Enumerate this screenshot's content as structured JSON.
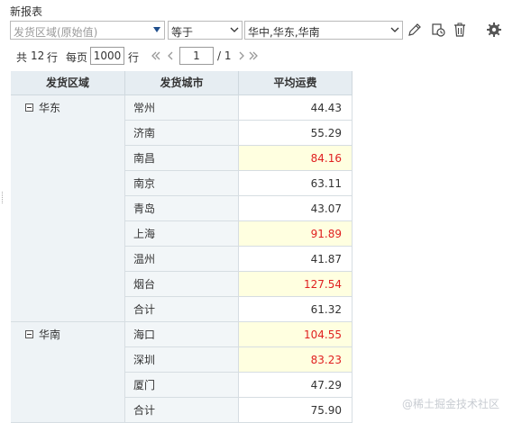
{
  "report": {
    "title": "新报表"
  },
  "filter": {
    "field_placeholder": "发货区域(原始值)",
    "operator": "等于",
    "value": "华中,华东,华南"
  },
  "pager": {
    "total_prefix": "共",
    "total_count": "12",
    "total_suffix": "行",
    "per_page_label": "每页",
    "per_page": "1000",
    "per_page_unit": "行",
    "current_page": "1",
    "total_pages": "/ 1"
  },
  "table": {
    "columns": [
      "发货区域",
      "发货城市",
      "平均运费"
    ],
    "regions": [
      {
        "name": "华东",
        "rows": [
          {
            "city": "常州",
            "value": "44.43",
            "highlight": false
          },
          {
            "city": "济南",
            "value": "55.29",
            "highlight": false
          },
          {
            "city": "南昌",
            "value": "84.16",
            "highlight": true
          },
          {
            "city": "南京",
            "value": "63.11",
            "highlight": false
          },
          {
            "city": "青岛",
            "value": "43.07",
            "highlight": false
          },
          {
            "city": "上海",
            "value": "91.89",
            "highlight": true
          },
          {
            "city": "温州",
            "value": "41.87",
            "highlight": false
          },
          {
            "city": "烟台",
            "value": "127.54",
            "highlight": true
          },
          {
            "city": "合计",
            "value": "61.32",
            "highlight": false
          }
        ]
      },
      {
        "name": "华南",
        "rows": [
          {
            "city": "海口",
            "value": "104.55",
            "highlight": true
          },
          {
            "city": "深圳",
            "value": "83.23",
            "highlight": true
          },
          {
            "city": "厦门",
            "value": "47.29",
            "highlight": false
          },
          {
            "city": "合计",
            "value": "75.90",
            "highlight": false
          }
        ]
      }
    ]
  },
  "colors": {
    "highlight_bg": "#ffffe0",
    "highlight_text": "#e02020",
    "header_bg": "#e6edf2"
  },
  "watermark": "@稀土掘金技术社区"
}
